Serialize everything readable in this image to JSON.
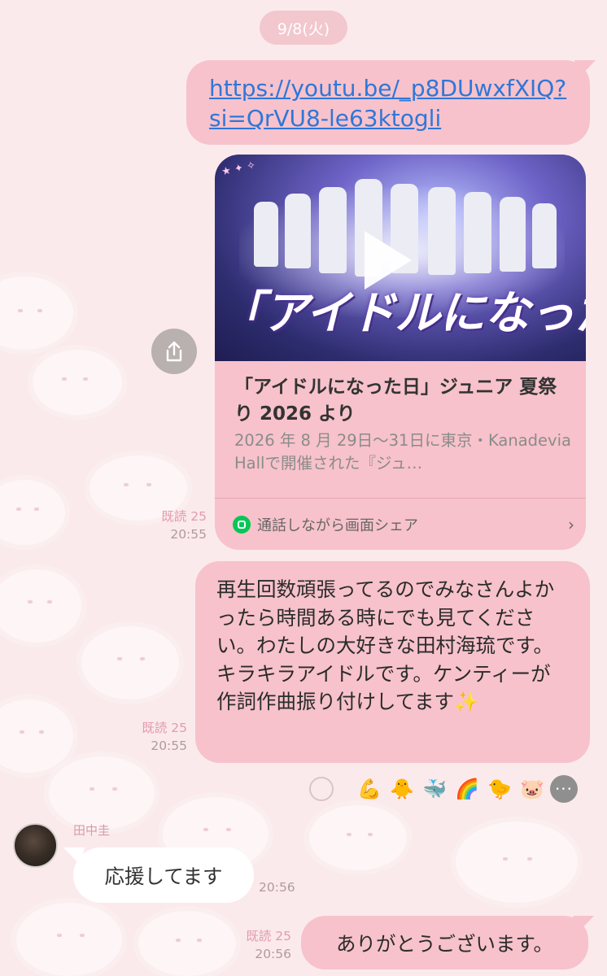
{
  "date_label": "9/8(火)",
  "messages": [
    {
      "type": "link",
      "url_text": "https://youtu.be/_p8DUwxfXIQ?si=QrVU8-le63ktogli",
      "preview": {
        "thumbnail_title": "「アイドルになった日」",
        "title": "「アイドルになった日」ジュニア 夏祭り 2026 より",
        "description": "2026 年 8 月 29日～31日に東京・Kanadevia Hallで開催された『ジュ…",
        "footer_label": "通話しながら画面シェア"
      },
      "read_label": "既読 25",
      "time": "20:55"
    },
    {
      "type": "text",
      "text": "再生回数頑張ってるのでみなさんよかったら時間ある時にでも見てください。わたしの大好きな田村海琉です。キラキラアイドルです。ケンティーが作詞作曲振り付けしてます✨",
      "read_label": "既読 25",
      "time": "20:55",
      "reactions": [
        "💪",
        "🐥",
        "🐳",
        "🌈",
        "🐤",
        "🐷"
      ]
    },
    {
      "type": "incoming",
      "sender": "田中圭",
      "text": "応援してます",
      "time": "20:56"
    },
    {
      "type": "text",
      "text": "ありがとうございます。",
      "read_label": "既読 25",
      "time": "20:56"
    }
  ],
  "colors": {
    "background": "#fbeaec",
    "bubble_out": "#f7c2cb",
    "bubble_in": "#ffffff",
    "link": "#2f77d8",
    "line_green": "#06c755"
  },
  "icons": {
    "share": "share-icon",
    "chevron": "chevron-right-icon",
    "line": "line-call-icon",
    "more": "more-icon",
    "add_reaction": "add-reaction-icon"
  }
}
